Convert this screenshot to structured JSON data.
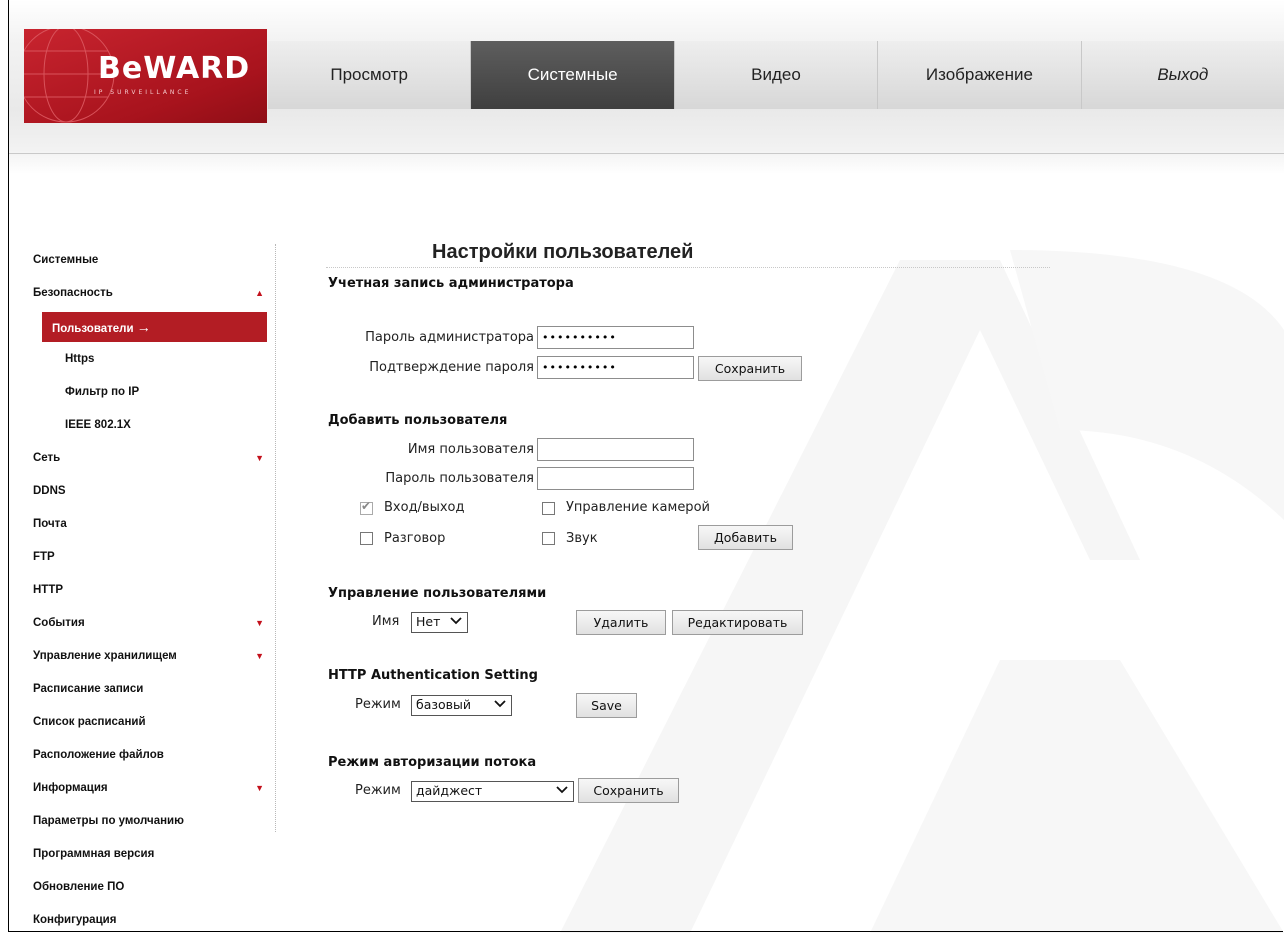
{
  "brand": {
    "logo_text": "BeWARD",
    "logo_sub": "IP SURVEILLANCE",
    "accent": "#b31d24"
  },
  "nav": {
    "items": [
      {
        "label": "Просмотр"
      },
      {
        "label": "Системные"
      },
      {
        "label": "Видео"
      },
      {
        "label": "Изображение"
      },
      {
        "label": "Выход"
      }
    ],
    "active": "Системные"
  },
  "sidebar": {
    "items": [
      {
        "label": "Системные"
      },
      {
        "label": "Безопасность",
        "arrow": "up"
      },
      {
        "label": "Пользователи",
        "active": true
      },
      {
        "label": "Https"
      },
      {
        "label": "Фильтр по IP"
      },
      {
        "label": "IEEE 802.1X"
      },
      {
        "label": "Сеть",
        "arrow": "down"
      },
      {
        "label": "DDNS"
      },
      {
        "label": "Почта"
      },
      {
        "label": "FTP"
      },
      {
        "label": "HTTP"
      },
      {
        "label": "События",
        "arrow": "down"
      },
      {
        "label": "Управление хранилищем",
        "arrow": "down"
      },
      {
        "label": "Расписание записи"
      },
      {
        "label": "Список расписаний"
      },
      {
        "label": "Расположение файлов"
      },
      {
        "label": "Информация",
        "arrow": "down"
      },
      {
        "label": "Параметры по умолчанию"
      },
      {
        "label": "Программная версия"
      },
      {
        "label": "Обновление ПО"
      },
      {
        "label": "Конфигурация"
      }
    ],
    "active_arrow": "→"
  },
  "main": {
    "title": "Настройки пользователей",
    "admin": {
      "heading": "Учетная запись администратора",
      "password_label": "Пароль администратора",
      "password_value": "••••••••••",
      "confirm_label": "Подтверждение пароля",
      "confirm_value": "••••••••••",
      "save_button": "Сохранить"
    },
    "add_user": {
      "heading": "Добавить пользователя",
      "name_label": "Имя пользователя",
      "name_value": "",
      "password_label": "Пароль пользователя",
      "password_value": "",
      "perm_login": "Вход/выход",
      "perm_login_checked": true,
      "perm_camera": "Управление камерой",
      "perm_camera_checked": false,
      "perm_talk": "Разговор",
      "perm_talk_checked": false,
      "perm_sound": "Звук",
      "perm_sound_checked": false,
      "add_button": "Добавить"
    },
    "manage": {
      "heading": "Управление пользователями",
      "name_label": "Имя",
      "name_selected": "Нет",
      "delete_button": "Удалить",
      "edit_button": "Редактировать"
    },
    "http_auth": {
      "heading": "HTTP Authentication Setting",
      "mode_label": "Режим",
      "mode_selected": "базовый",
      "save_button": "Save"
    },
    "stream_auth": {
      "heading": "Режим авторизации потока",
      "mode_label": "Режим",
      "mode_selected": "дайджест",
      "save_button": "Сохранить"
    }
  }
}
